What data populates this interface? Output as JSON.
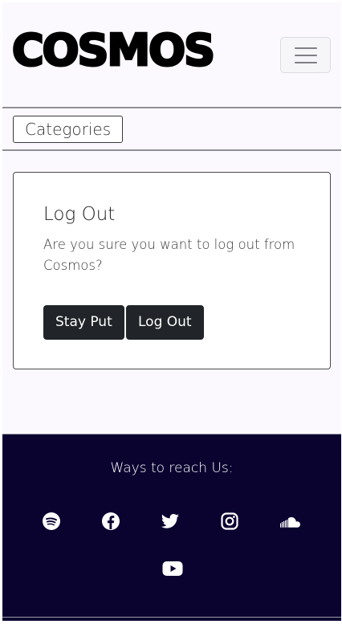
{
  "header": {
    "logo_text": "COSMOS",
    "menu_toggle_icon": "hamburger-icon"
  },
  "nav": {
    "categories_label": "Categories"
  },
  "logout_card": {
    "title": "Log Out",
    "message": "Are you sure you want to log out from Cosmos?",
    "stay_label": "Stay Put",
    "logout_label": "Log Out"
  },
  "footer": {
    "title": "Ways to reach Us:",
    "social_icons": [
      "spotify-icon",
      "facebook-icon",
      "twitter-icon",
      "instagram-icon",
      "soundcloud-icon",
      "youtube-icon"
    ],
    "background_color": "#0a0330"
  }
}
